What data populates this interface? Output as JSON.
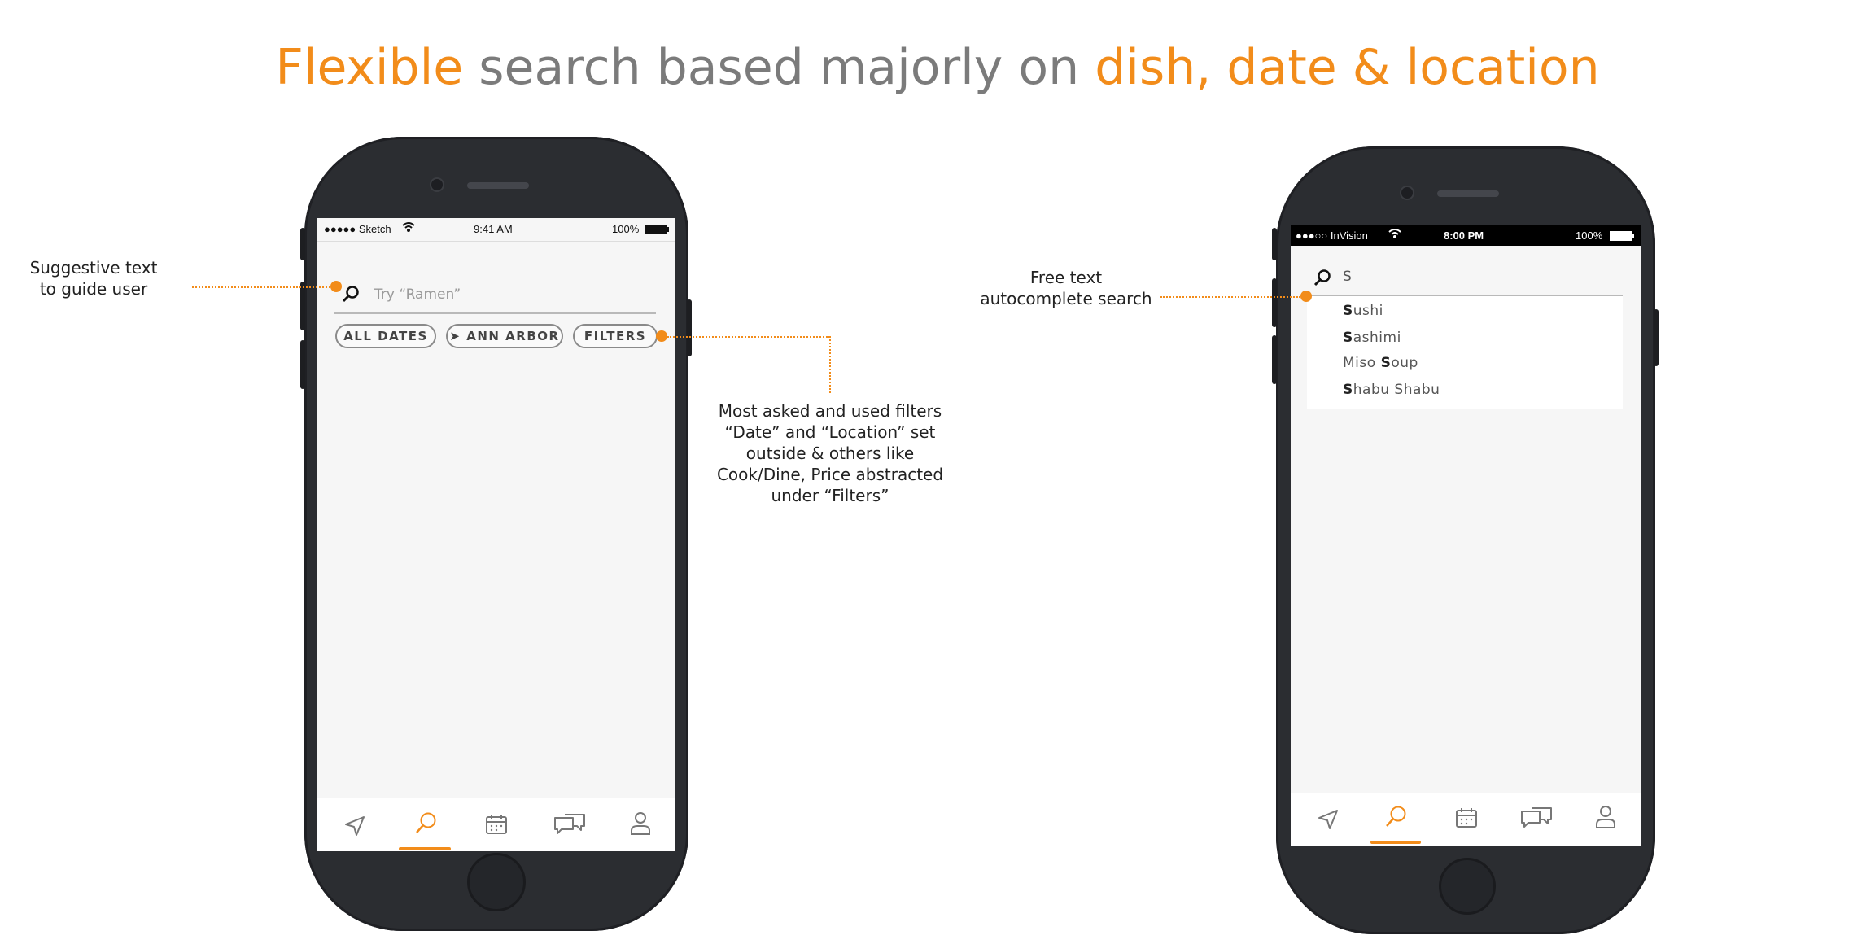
{
  "title": {
    "part1": "Flexible",
    "part2": " search based majorly on ",
    "part3": "dish, date & location"
  },
  "colors": {
    "accent": "#f28c1a",
    "muted": "#7b7b7b"
  },
  "phone_left": {
    "status": {
      "carrier": "●●●●● Sketch",
      "time": "9:41 AM",
      "battery": "100%"
    },
    "search": {
      "placeholder": "Try “Ramen”",
      "icon": "search-icon"
    },
    "chips": {
      "dates": "ALL DATES",
      "location": "ANN ARBOR",
      "filters": "FILTERS"
    },
    "tabs": [
      "navigate-icon",
      "search-icon",
      "calendar-icon",
      "chat-icon",
      "user-icon"
    ],
    "active_tab": "search"
  },
  "phone_right": {
    "status": {
      "carrier": "●●●○○ InVision",
      "time": "8:00 PM",
      "battery": "100%"
    },
    "search": {
      "value": "S",
      "icon": "search-icon"
    },
    "suggestions": [
      {
        "bold": "S",
        "rest": "ushi"
      },
      {
        "bold": "S",
        "rest": "ashimi"
      },
      {
        "pre": "Miso ",
        "bold": "S",
        "rest": "oup"
      },
      {
        "bold": "S",
        "rest": "habu Shabu"
      }
    ],
    "tabs": [
      "navigate-icon",
      "search-icon",
      "calendar-icon",
      "chat-icon",
      "user-icon"
    ],
    "active_tab": "search"
  },
  "annotations": {
    "suggestive": [
      "Suggestive text",
      "to guide user"
    ],
    "filters": [
      "Most asked and used filters",
      "“Date” and “Location” set",
      "outside & others like",
      "Cook/Dine, Price abstracted",
      "under “Filters”"
    ],
    "freetext": [
      "Free text",
      "autocomplete search"
    ]
  }
}
